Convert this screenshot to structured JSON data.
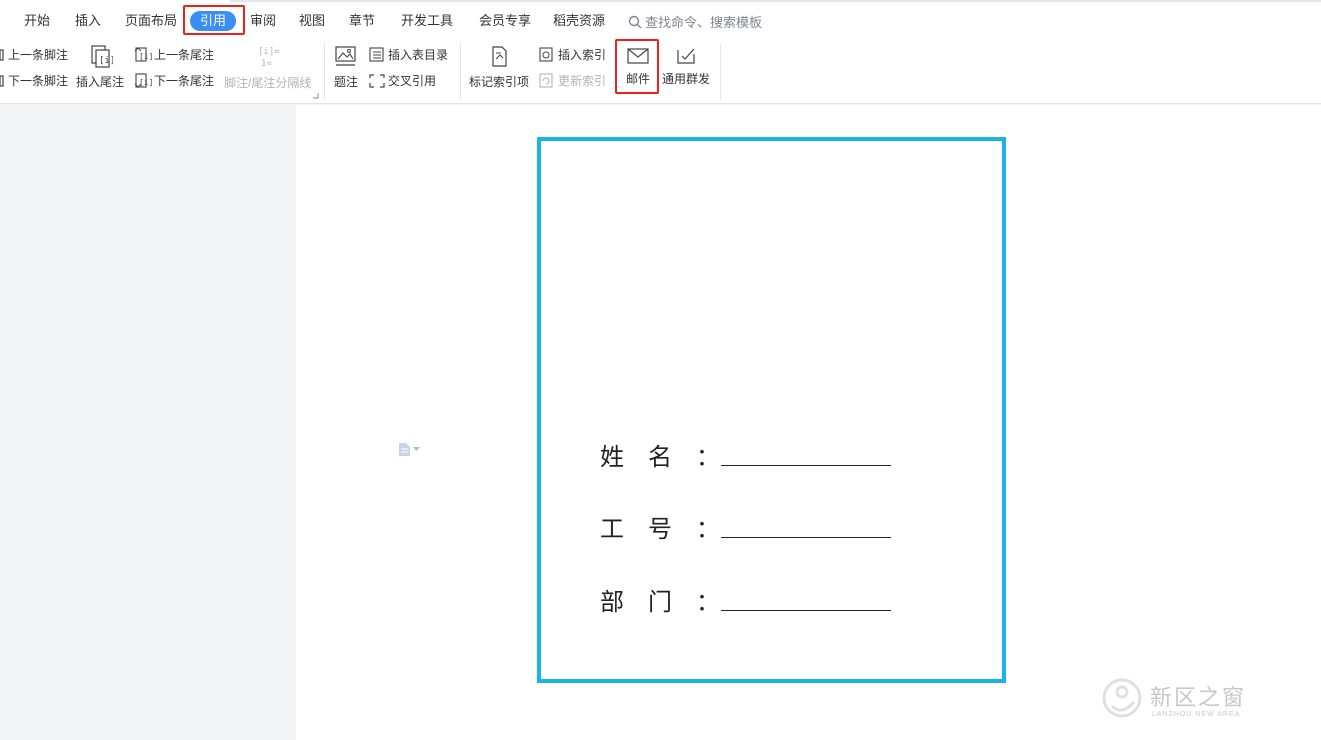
{
  "tabs": [
    "开始",
    "插入",
    "页面布局",
    "引用",
    "审阅",
    "视图",
    "章节",
    "开发工具",
    "会员专享",
    "稻壳资源"
  ],
  "search_placeholder": "查找命令、搜索模板",
  "ribbon": {
    "prev_footnote": "上一条脚注",
    "next_footnote": "下一条脚注",
    "insert_endnote": "插入尾注",
    "prev_endnote": "上一条尾注",
    "next_endnote": "下一条尾注",
    "separator_line": "脚注/尾注分隔线",
    "caption": "题注",
    "insert_table_of_figures": "插入表目录",
    "cross_reference": "交叉引用",
    "mark_index_entry": "标记索引项",
    "insert_index": "插入索引",
    "update_index": "更新索引",
    "mail": "邮件",
    "mass_send": "通用群发"
  },
  "form": {
    "name_label": "姓　名　：",
    "id_label": "工　号　：",
    "dept_label": "部　门　："
  },
  "watermark": {
    "text": "新区之窗",
    "sub": "LANZHOU NEW AREA"
  },
  "colors": {
    "accent": "#3a8ef6",
    "highlight": "#e8231c",
    "frame": "#1ab2e8"
  }
}
